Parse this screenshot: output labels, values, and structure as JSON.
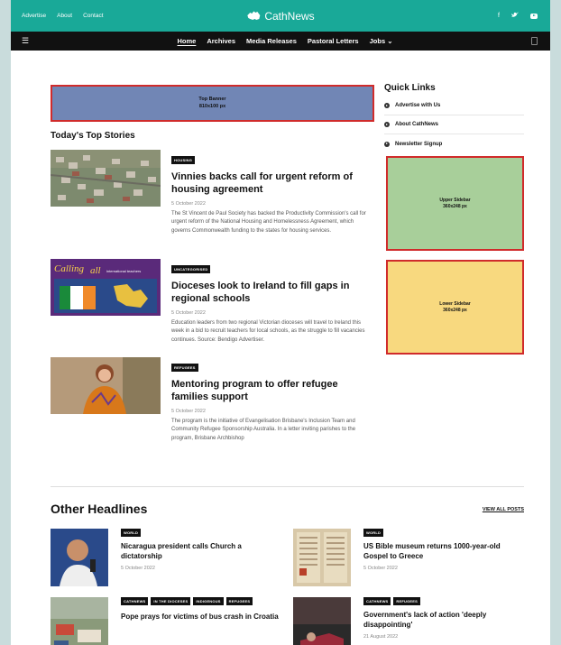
{
  "topbar": {
    "links": [
      "Advertise",
      "About",
      "Contact"
    ],
    "logo": "CathNews",
    "social": {
      "facebook": "f",
      "twitter": "♥",
      "youtube": "youtube-icon"
    }
  },
  "nav": {
    "items": [
      "Home",
      "Archives",
      "Media Releases",
      "Pastoral Letters"
    ],
    "jobs": "Jobs ⌄"
  },
  "banner": {
    "line1": "Top Banner",
    "line2": "810x100 px"
  },
  "top_stories": {
    "heading": "Today's Top Stories",
    "items": [
      {
        "tag": "HOUSING",
        "title": "Vinnies backs call for urgent reform of housing agreement",
        "date": "5 October 2022",
        "excerpt": "The St Vincent de Paul Society has backed the Productivity Commission's call for urgent reform of the National Housing and Homelessness Agreement, which governs Commonwealth funding to the states for housing services."
      },
      {
        "tag": "UNCATEGORISED",
        "title": "Dioceses look to Ireland to fill gaps in regional schools",
        "date": "5 October 2022",
        "excerpt": "Education leaders from two regional Victorian dioceses will travel to Ireland this week in a bid to recruit teachers for local schools, as the struggle to fill vacancies continues. Source: Bendigo Advertiser."
      },
      {
        "tag": "REFUGEES",
        "title": "Mentoring program to offer refugee families support",
        "date": "5 October 2022",
        "excerpt": "The program is the initiative of Evangelisation Brisbane's Inclusion Team and Community Refugee Sponsorship Australia. In a letter inviting parishes to the program, Brisbane Archbishop"
      }
    ]
  },
  "quick_links": {
    "heading": "Quick Links",
    "items": [
      "Advertise with Us",
      "About CathNews",
      "Newsletter Signup"
    ]
  },
  "ads": {
    "upper": {
      "line1": "Upper Sidebar",
      "line2": "360x248 px"
    },
    "lower": {
      "line1": "Lower Sidebar",
      "line2": "360x248 px"
    }
  },
  "thumb_text": {
    "calling": "Calling",
    "all": "all",
    "teachers": "international teachers"
  },
  "other": {
    "heading": "Other Headlines",
    "view_all": "VIEW ALL POSTS",
    "items": [
      {
        "tags": [
          "WORLD"
        ],
        "title": "Nicaragua president calls Church a dictatorship",
        "date": "5 October 2022"
      },
      {
        "tags": [
          "WORLD"
        ],
        "title": "US Bible museum returns 1000-year-old Gospel to Greece",
        "date": "5 October 2022"
      },
      {
        "tags": [
          "CATHNEWS",
          "IN THE DIOCESES",
          "INDIGENOUS",
          "REFUGEES"
        ],
        "title": "Pope prays for victims of bus crash in Croatia",
        "date": ""
      },
      {
        "tags": [
          "CATHNEWS",
          "REFUGEES"
        ],
        "title": "Government's lack of action 'deeply disappointing'",
        "date": "21 August 2022"
      }
    ]
  },
  "colors": {
    "teal": "#19a998",
    "nav": "#111111",
    "banner": "#7186b5",
    "upper_ad": "#a8cf9a",
    "lower_ad": "#f8d97f",
    "ad_border": "#d02b2b"
  }
}
